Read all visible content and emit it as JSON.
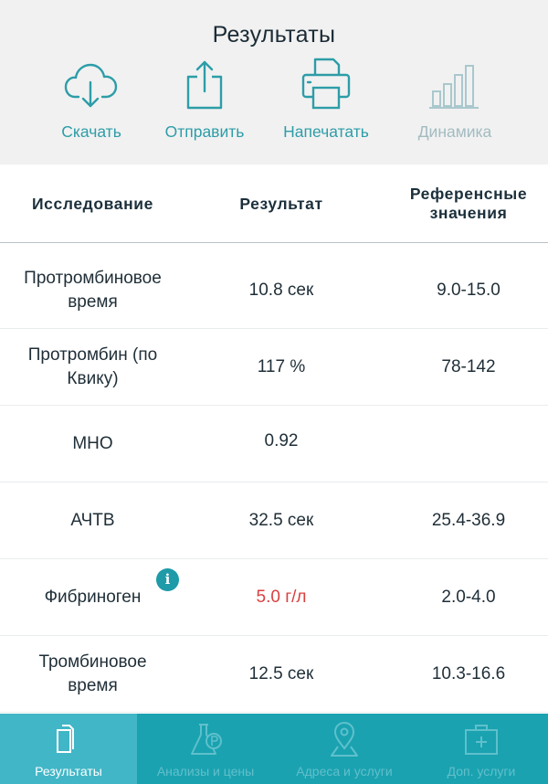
{
  "header": {
    "title": "Результаты",
    "actions": [
      {
        "label": "Скачать",
        "icon": "cloud-download-icon",
        "enabled": true
      },
      {
        "label": "Отправить",
        "icon": "share-icon",
        "enabled": true
      },
      {
        "label": "Напечатать",
        "icon": "printer-icon",
        "enabled": true
      },
      {
        "label": "Динамика",
        "icon": "bar-chart-icon",
        "enabled": false
      }
    ]
  },
  "table": {
    "columns": [
      "Исследование",
      "Результат",
      "Референсные значения"
    ],
    "rows": [
      {
        "test": "Протромбиновое время",
        "result": "10.8 сек",
        "reference": "9.0-15.0"
      },
      {
        "test": "Протромбин (по Квику)",
        "result": "117 %",
        "reference": "78-142"
      },
      {
        "test": "МНО",
        "result": "0.92",
        "reference": ""
      },
      {
        "test": "АЧТВ",
        "result": "32.5 сек",
        "reference": "25.4-36.9"
      },
      {
        "test": "Фибриноген",
        "result": "5.0 г/л",
        "reference": "2.0-4.0",
        "info": "i",
        "out_of_range": true
      },
      {
        "test": "Тромбиновое время",
        "result": "12.5 сек",
        "reference": "10.3-16.6"
      }
    ]
  },
  "tabbar": {
    "tabs": [
      {
        "label": "Результаты",
        "icon": "document-icon",
        "active": true
      },
      {
        "label": "Анализы и цены",
        "icon": "flask-icon",
        "active": false
      },
      {
        "label": "Адреса и услуги",
        "icon": "map-pin-icon",
        "active": false
      },
      {
        "label": "Доп. услуги",
        "icon": "first-aid-kit-icon",
        "active": false
      }
    ]
  },
  "colors": {
    "accent": "#2d9da8",
    "tabbar": "#1aa2b0",
    "tab_active": "#41b6c7",
    "alert": "#d8413f",
    "header_bg": "#f1f1f1"
  }
}
